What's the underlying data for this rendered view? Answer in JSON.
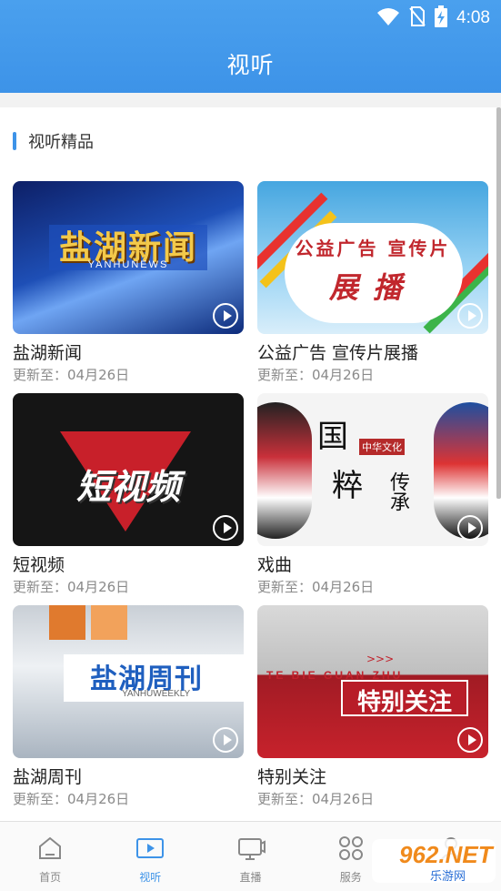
{
  "status_bar": {
    "time": "4:08",
    "icons": [
      "wifi-icon",
      "no-sim-icon",
      "battery-charging-icon"
    ]
  },
  "header": {
    "title": "视听"
  },
  "section": {
    "title": "视听精品"
  },
  "cards": [
    {
      "title": "盐湖新闻",
      "date": "更新至：04月26日",
      "thumb_text": "盐湖新闻",
      "thumb_sub": "YANHUNEWS"
    },
    {
      "title": "公益广告 宣传片展播",
      "date": "更新至：04月26日",
      "thumb_line1": "公益广告 宣传片",
      "thumb_line2": "展播"
    },
    {
      "title": "短视频",
      "date": "更新至：04月26日",
      "thumb_text": "短视频"
    },
    {
      "title": "戏曲",
      "date": "更新至：04月26日",
      "thumb_c1": "国",
      "thumb_c2": "粹",
      "thumb_c3": "传承",
      "thumb_seal": "中华文化"
    },
    {
      "title": "盐湖周刊",
      "date": "更新至：04月26日",
      "thumb_text": "盐湖周刊",
      "thumb_sub": "YANHUWEEKLY"
    },
    {
      "title": "特别关注",
      "date": "更新至：04月26日",
      "thumb_text": "特别关注",
      "thumb_runner": "TE BIE GUAN ZHU",
      "thumb_arrows": ">>>"
    }
  ],
  "tabs": [
    {
      "label": "首页",
      "icon": "home-icon",
      "active": false
    },
    {
      "label": "视听",
      "icon": "play-video-icon",
      "active": true
    },
    {
      "label": "直播",
      "icon": "live-tv-icon",
      "active": false
    },
    {
      "label": "服务",
      "icon": "services-grid-icon",
      "active": false
    },
    {
      "label": "",
      "icon": "profile-icon",
      "active": false
    }
  ],
  "watermark": {
    "text1": "962.NET",
    "text2": "乐游网"
  },
  "colors": {
    "accent": "#3d93e8",
    "header": "#4aa0ee"
  }
}
